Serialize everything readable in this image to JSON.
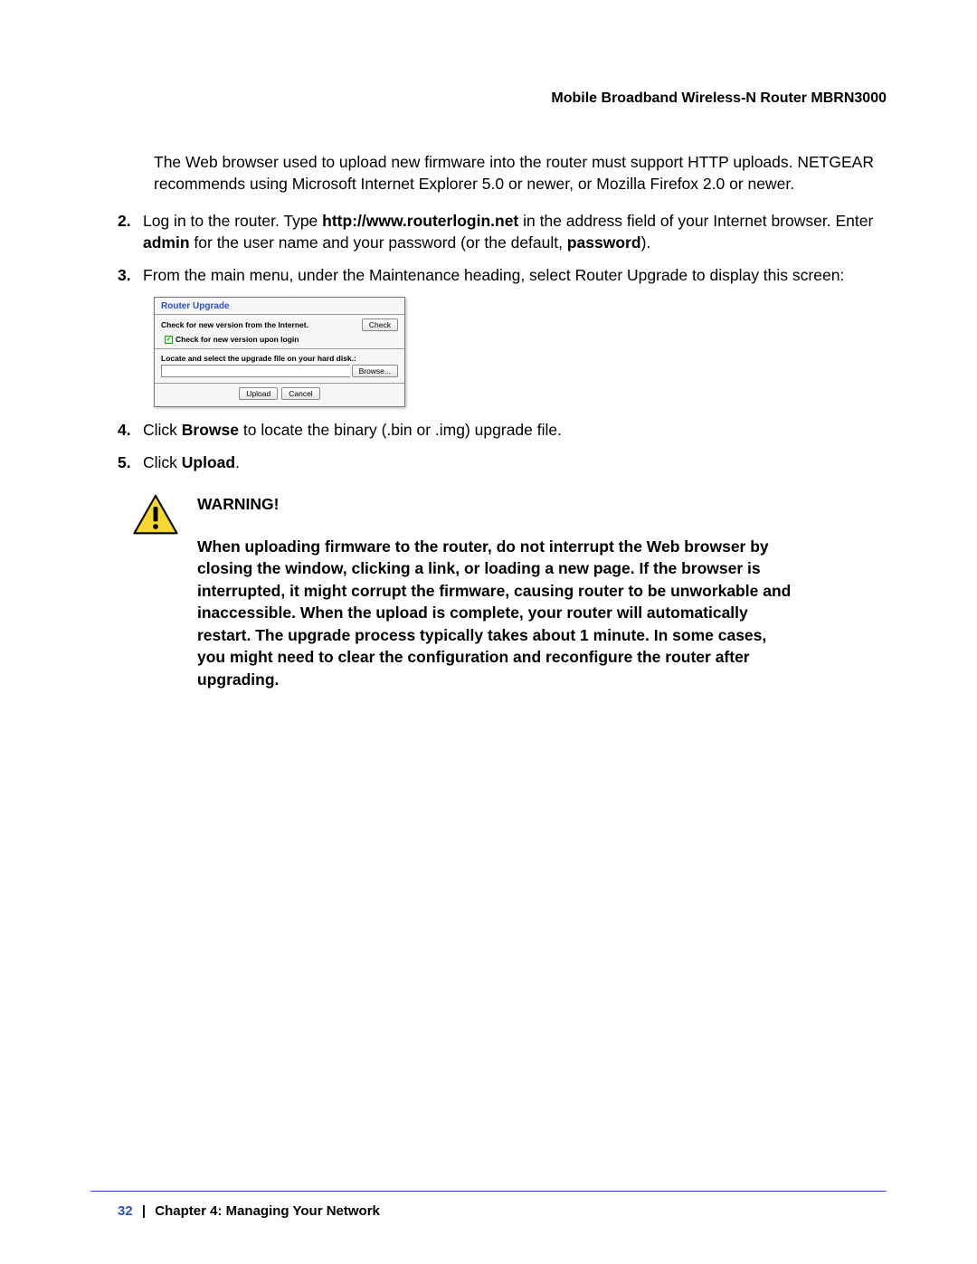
{
  "header": {
    "title": "Mobile Broadband Wireless-N Router MBRN3000"
  },
  "intro": "The Web browser used to upload new firmware into the router must support HTTP uploads. NETGEAR recommends using Microsoft Internet Explorer 5.0 or newer, or Mozilla Firefox 2.0 or newer.",
  "steps": {
    "s2": {
      "num": "2.",
      "pre": "Log in to the router. Type ",
      "url": "http://www.routerlogin.net",
      "mid": " in the address field of your Internet browser. Enter ",
      "user": "admin",
      "mid2": " for the user name and your password (or the default, ",
      "pwd": "password",
      "post": ")."
    },
    "s3": {
      "num": "3.",
      "text": "From the main menu, under the Maintenance heading, select Router Upgrade to display this screen:"
    },
    "s4": {
      "num": "4.",
      "pre": "Click ",
      "bold": "Browse",
      "post": " to locate the binary (.bin or .img) upgrade file."
    },
    "s5": {
      "num": "5.",
      "pre": "Click ",
      "bold": "Upload",
      "post": "."
    }
  },
  "screenshot": {
    "title": "Router Upgrade",
    "check_label": "Check for new version from the Internet.",
    "check_btn": "Check",
    "checkbox_label": "Check for new version upon login",
    "locate_label": "Locate and select the upgrade file on your hard disk.:",
    "browse_btn": "Browse...",
    "upload_btn": "Upload",
    "cancel_btn": "Cancel"
  },
  "warning": {
    "heading": "WARNING!",
    "body": "When uploading firmware to the router, do not interrupt the Web browser by closing the window, clicking a link, or loading a new page. If the browser is interrupted, it might corrupt the firmware, causing router to be unworkable and inaccessible. When the upload is complete, your router will automatically restart. The upgrade process typically takes about 1 minute. In some cases, you might need to clear the configuration and reconfigure the router after upgrading."
  },
  "footer": {
    "page": "32",
    "sep": "|",
    "chapter": "Chapter 4:  Managing Your Network"
  }
}
